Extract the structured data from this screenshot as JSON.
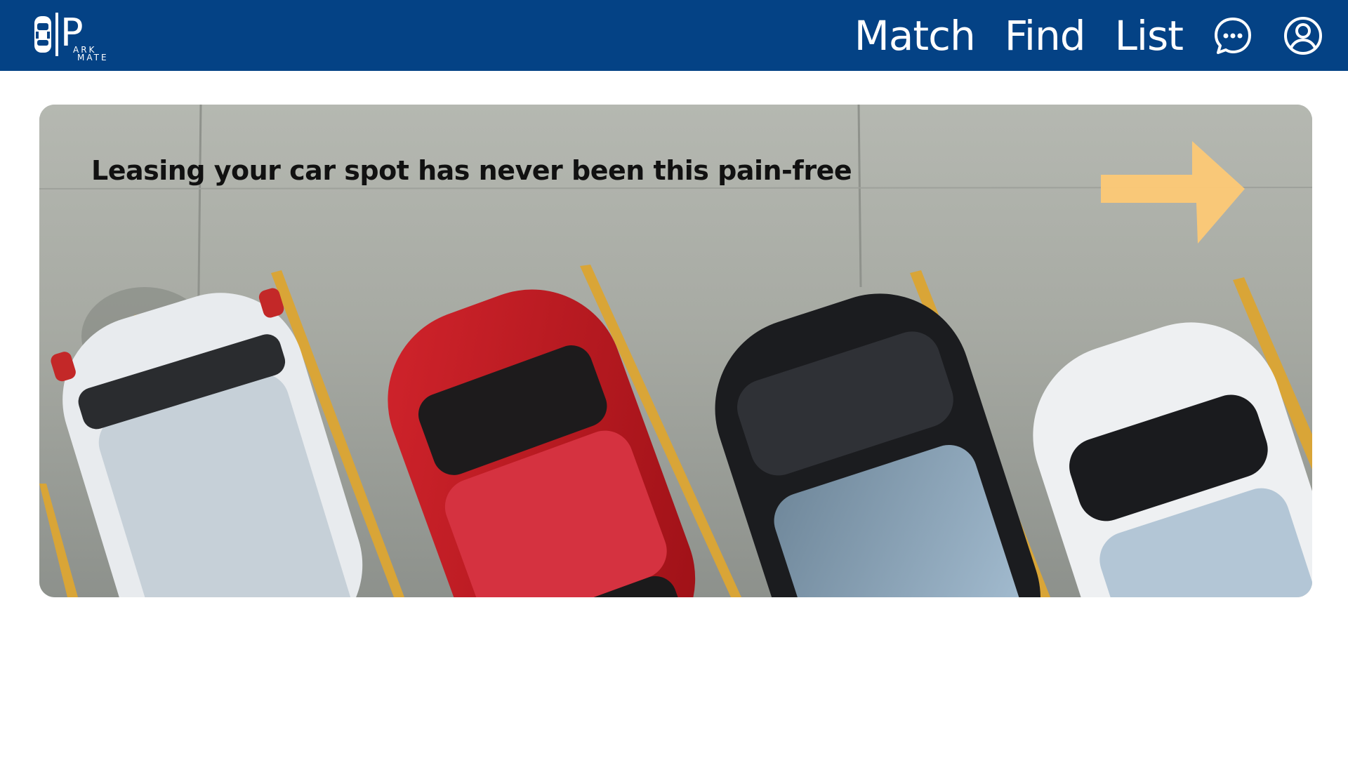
{
  "app": {
    "logo_icon": "parking-car-logo",
    "logo_text": "PARK MATE",
    "logo_letter": "P",
    "logo_sub_top": "ARK",
    "logo_sub_bottom": "MATE",
    "brand_color": "#044285"
  },
  "nav": {
    "items": [
      {
        "label": "Match"
      },
      {
        "label": "Find"
      },
      {
        "label": "List"
      }
    ],
    "chat_icon": "chat-bubble-icon",
    "profile_icon": "user-circle-icon"
  },
  "hero": {
    "headline": "Leasing your car spot has never been this pain-free",
    "arrow_icon": "arrow-right-icon",
    "arrow_color": "#fdc975",
    "image": "aerial view of parked cars (white, red, black, white) with yellow lines"
  }
}
